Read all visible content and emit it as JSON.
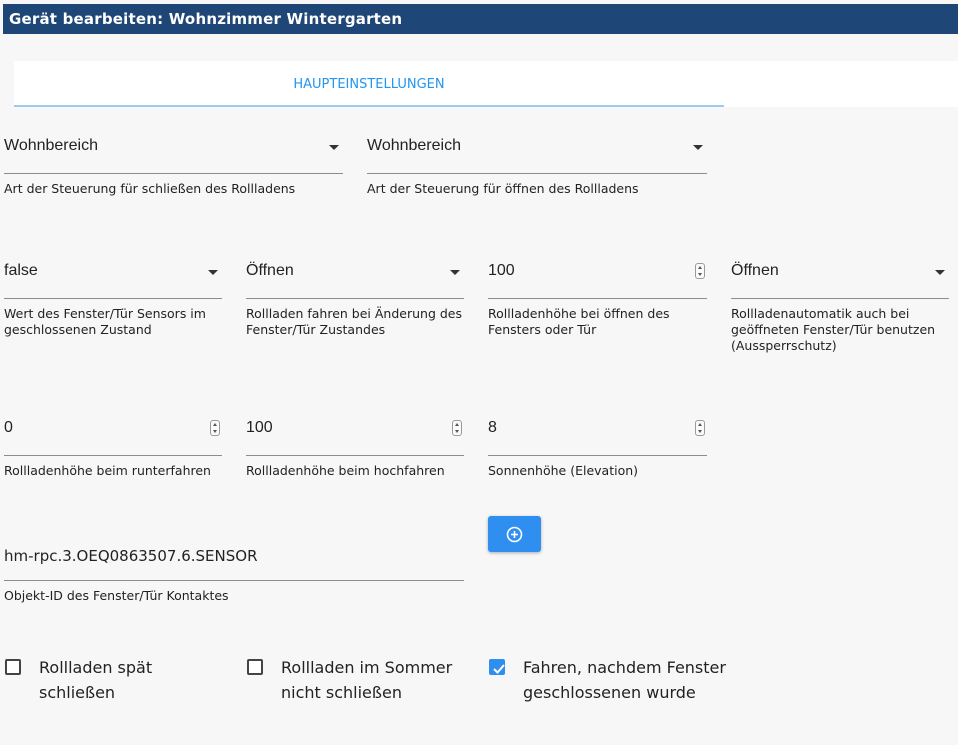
{
  "window": {
    "title": "Gerät bearbeiten: Wohnzimmer Wintergarten"
  },
  "tabs": [
    {
      "label": "HAUPTEINSTELLUNGEN",
      "active": true
    }
  ],
  "fields": {
    "close_control": {
      "value": "Wohnbereich",
      "helper": "Art der Steuerung für schließen des Rollladens"
    },
    "open_control": {
      "value": "Wohnbereich",
      "helper": "Art der Steuerung für öffnen des Rollladens"
    },
    "sensor_closed_value": {
      "value": "false",
      "helper": "Wert des Fenster/Tür Sensors im geschlossenen Zustand"
    },
    "move_on_change": {
      "value": "Öffnen",
      "helper": "Rollladen fahren bei Änderung des Fenster/Tür Zustandes"
    },
    "open_height": {
      "value": "100",
      "helper": "Rollladenhöhe bei öffnen des Fensters oder Tür"
    },
    "automation_open": {
      "value": "Öffnen",
      "helper": "Rollladenautomatik auch bei geöffneten Fenster/Tür benutzen (Aussperrschutz)"
    },
    "down_height": {
      "value": "0",
      "helper": "Rollladenhöhe beim runterfahren"
    },
    "up_height": {
      "value": "100",
      "helper": "Rollladenhöhe beim hochfahren"
    },
    "elevation": {
      "value": "8",
      "helper": "Sonnenhöhe (Elevation)"
    },
    "object_id": {
      "value": "hm-rpc.3.OEQ0863507.6.SENSOR",
      "helper": "Objekt-ID des Fenster/Tür Kontaktes"
    }
  },
  "buttons": {
    "add": {
      "icon": "plus-circle-icon"
    }
  },
  "checkboxes": [
    {
      "label": "Rollladen spät schließen",
      "checked": false
    },
    {
      "label": "Rollladen im Sommer nicht schließen",
      "checked": false
    },
    {
      "label": "Fahren, nachdem Fenster geschlossenen wurde",
      "checked": true
    }
  ],
  "colors": {
    "titlebar": "#1e4677",
    "accent": "#2196f3",
    "button": "#2f8ff0"
  }
}
